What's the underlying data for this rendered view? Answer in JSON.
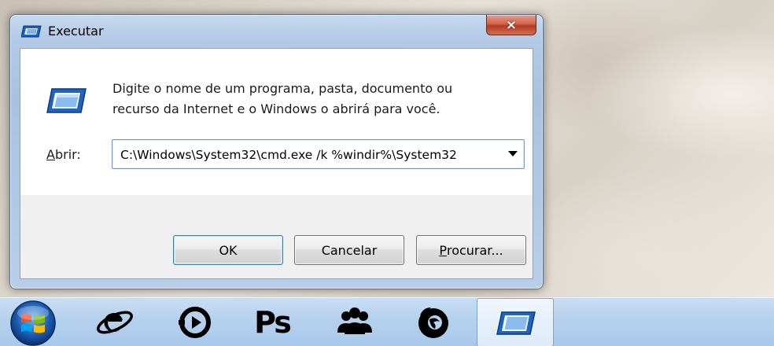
{
  "window": {
    "title": "Executar",
    "close_label": "×",
    "description": "Digite o nome de um programa, pasta, documento ou recurso da Internet e o Windows o abrirá para você.",
    "description_line1": "Digite o nome de um programa, pasta, documento ou",
    "description_line2": "recurso da Internet e o Windows o abrirá para você.",
    "open_label_accel": "A",
    "open_label_rest": "brir:",
    "command_value": "C:\\Windows\\System32\\cmd.exe /k %windir%\\System32",
    "buttons": {
      "ok": "OK",
      "cancel": "Cancelar",
      "browse_accel": "P",
      "browse_rest": "rocurar..."
    }
  },
  "taskbar": {
    "items": [
      {
        "icon": "start-orb-icon"
      },
      {
        "icon": "internet-explorer-icon"
      },
      {
        "icon": "media-player-icon"
      },
      {
        "icon": "photoshop-icon",
        "text": "Ps"
      },
      {
        "icon": "people-icon"
      },
      {
        "icon": "firefox-icon"
      },
      {
        "icon": "run-dialog-icon",
        "active": true
      }
    ]
  },
  "colors": {
    "window_frame": "#b4cbe6",
    "close_button": "#c9553f",
    "taskbar": "#b7d2ee",
    "default_button_border": "#3c7fb1"
  }
}
